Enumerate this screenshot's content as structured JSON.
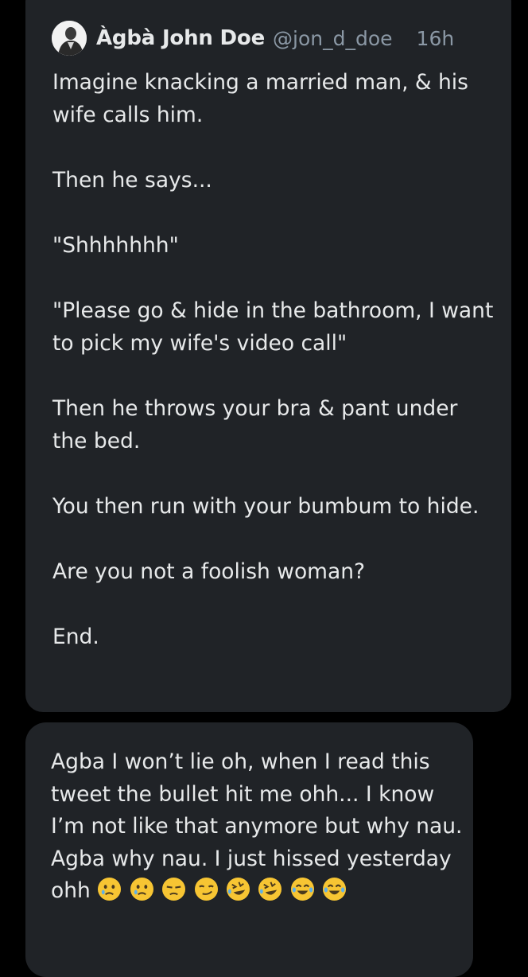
{
  "tweet": {
    "display_name": "Àgbà John Doe",
    "handle": "@jon_d_doe",
    "time": "16h",
    "paragraphs": [
      "Imagine knacking a married man, & his wife calls him.",
      "Then he says...",
      "\"Shhhhhhh\"",
      "\"Please go & hide in the bathroom, I want to pick my wife's video call\"",
      "Then he throws your bra & pant under the bed.",
      "You then run with your bumbum to hide.",
      "Are you not a foolish woman?",
      "End."
    ]
  },
  "reply": {
    "text": "Agba I won’t lie oh, when I read this tweet the bullet hit me ohh... I know I’m not like that anymore but why nau. Agba why nau. I just hissed yesterday ohh",
    "emojis": [
      "crying-face-emoji",
      "crying-face-emoji",
      "unamused-face-emoji",
      "smirking-face-emoji",
      "rolling-on-floor-laughing-emoji",
      "rolling-on-floor-laughing-emoji",
      "tears-of-joy-emoji",
      "tears-of-joy-emoji"
    ]
  },
  "colors": {
    "background": "#000000",
    "card": "#202327",
    "text": "#e7e9ea",
    "muted": "#8b98a5",
    "emoji_yellow": "#f7c533"
  }
}
